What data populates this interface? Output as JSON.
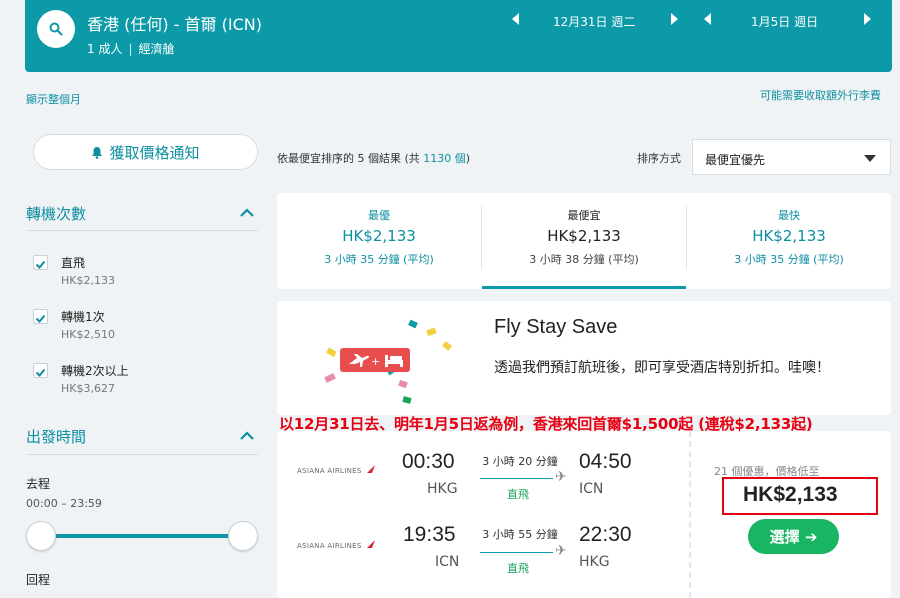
{
  "header": {
    "route": "香港 (任何) - 首爾 (ICN)",
    "passengers": "1 成人",
    "cabin": "經濟艙",
    "depart_date": "12月31日 週二",
    "return_date": "1月5日 週日"
  },
  "links": {
    "show_month": "顯示整個月",
    "extra_fees": "可能需要收取額外行李費"
  },
  "price_alert": {
    "label": "獲取價格通知"
  },
  "filters": {
    "stops_title": "轉機次數",
    "items": [
      {
        "label": "直飛",
        "price": "HK$2,133",
        "checked": true
      },
      {
        "label": "轉機1次",
        "price": "HK$2,510",
        "checked": true
      },
      {
        "label": "轉機2次以上",
        "price": "HK$3,627",
        "checked": true
      }
    ],
    "depart_time_title": "出發時間",
    "outbound_label": "去程",
    "outbound_range": "00:00 – 23:59",
    "return_label": "回程"
  },
  "results": {
    "prefix": "依最便宜排序的 5 個結果 (共 ",
    "total": "1130 個",
    "suffix": ")",
    "sort_label": "排序方式",
    "sort_value": "最便宜優先"
  },
  "tabs": [
    {
      "label": "最優",
      "price": "HK$2,133",
      "duration": "3 小時 35 分鐘 (平均)"
    },
    {
      "label": "最便宜",
      "price": "HK$2,133",
      "duration": "3 小時 38 分鐘 (平均)"
    },
    {
      "label": "最快",
      "price": "HK$2,133",
      "duration": "3 小時 35 分鐘 (平均)"
    }
  ],
  "promo": {
    "title": "Fly Stay Save",
    "text": "透過我們預訂航班後，即可享受酒店特別折扣。哇噢！"
  },
  "overlay_text": "以12月31日去、明年1月5日返為例，香港來回首爾$1,500起 (連稅$2,133起)",
  "flight": {
    "airline": "ASIANA AIRLINES",
    "outbound": {
      "dep_time": "00:30",
      "dep_code": "HKG",
      "arr_time": "04:50",
      "arr_code": "ICN",
      "duration": "3 小時 20 分鐘",
      "stops": "直飛"
    },
    "inbound": {
      "dep_time": "19:35",
      "dep_code": "ICN",
      "arr_time": "22:30",
      "arr_code": "HKG",
      "duration": "3 小時 55 分鐘",
      "stops": "直飛"
    },
    "deals": "21 個優惠，價格低至",
    "price": "HK$2,133",
    "select_label": "選擇 ➔"
  },
  "colors": {
    "teal": "#0d9aa8",
    "green": "#19b563",
    "highlight_red": "#e60012"
  }
}
